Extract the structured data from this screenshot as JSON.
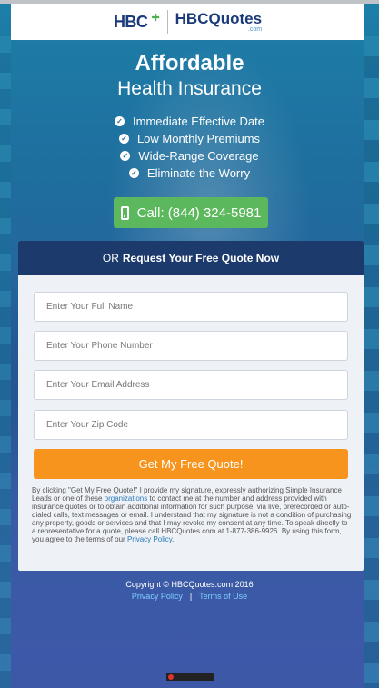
{
  "header": {
    "logo_hbc": "HBC",
    "logo_quotes": "HBCQuotes",
    "logo_com": ".com"
  },
  "hero": {
    "title": "Affordable",
    "subtitle": "Health Insurance",
    "features": [
      "Immediate Effective Date",
      "Low Monthly Premiums",
      "Wide-Range Coverage",
      "Eliminate the Worry"
    ],
    "call_label": "Call: (844) 324-5981"
  },
  "form": {
    "header_prefix": "OR",
    "header_strong": "Request Your Free Quote Now",
    "fields": {
      "name_placeholder": "Enter Your Full Name",
      "phone_placeholder": "Enter Your Phone Number",
      "email_placeholder": "Enter Your Email Address",
      "zip_placeholder": "Enter Your Zip Code"
    },
    "submit_label": "Get My Free Quote!",
    "disclaimer": {
      "part1": "By clicking \"Get My Free Quote!\" I provide my signature, expressly authorizing Simple Insurance Leads or one of these ",
      "link1": "organizations",
      "part2": " to contact me at the number and address provided with insurance quotes or to obtain additional information for such purpose, via live, prerecorded or auto-dialed calls, text messages or email. I understand that my signature is not a condition of purchasing any property, goods or services and that I may revoke my consent at any time. To speak directly to a representative for a quote, please call HBCQuotes.com at 1-877-386-9926. By using this form, you agree to the terms of our ",
      "link2": "Privacy Policy",
      "part3": "."
    }
  },
  "footer": {
    "copyright": "Copyright © HBCQuotes.com 2016",
    "privacy_link": "Privacy Policy",
    "separator": "|",
    "terms_link": "Terms of Use"
  },
  "colors": {
    "header_navy": "#1c3a6b",
    "call_green": "#5cb85c",
    "submit_orange": "#f7941d",
    "link_blue": "#2a7ab8"
  }
}
